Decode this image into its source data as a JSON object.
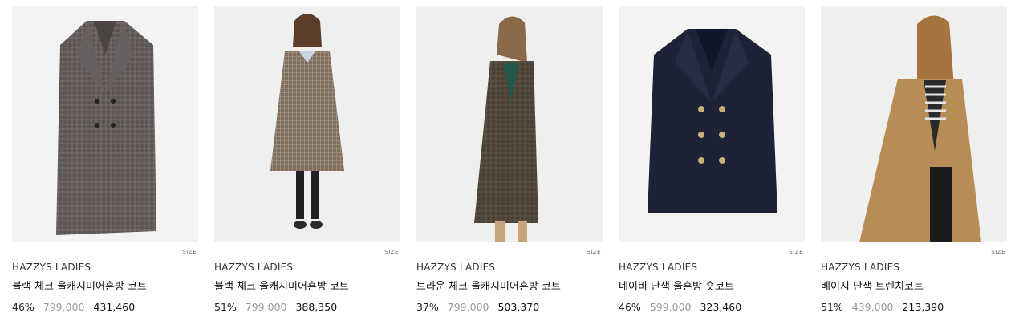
{
  "products": [
    {
      "brand": "HAZZYS LADIES",
      "name": "블랙 체크 울캐시미어혼방 코트",
      "discount": "46%",
      "original_price": "799,000",
      "sale_price": "431,460",
      "size_label": "SIZE",
      "coat_color": "#5b5553",
      "bg_color": "#f3f3f3"
    },
    {
      "brand": "HAZZYS LADIES",
      "name": "블랙 체크 울캐시미어혼방 코트",
      "discount": "51%",
      "original_price": "799,000",
      "sale_price": "388,350",
      "size_label": "SIZE",
      "coat_color": "#7d6e60",
      "bg_color": "#efefee"
    },
    {
      "brand": "HAZZYS LADIES",
      "name": "브라운 체크 울캐시미어혼방 코트",
      "discount": "37%",
      "original_price": "799,000",
      "sale_price": "503,370",
      "size_label": "SIZE",
      "coat_color": "#4a4236",
      "bg_color": "#efefee"
    },
    {
      "brand": "HAZZYS LADIES",
      "name": "네이비 단색 울혼방 숏코트",
      "discount": "46%",
      "original_price": "599,000",
      "sale_price": "323,460",
      "size_label": "SIZE",
      "coat_color": "#1d2236",
      "bg_color": "#f3f3f3"
    },
    {
      "brand": "HAZZYS LADIES",
      "name": "베이지 단색 트렌치코트",
      "discount": "51%",
      "original_price": "439,000",
      "sale_price": "213,390",
      "size_label": "SIZE",
      "coat_color": "#b78c57",
      "bg_color": "#efefee"
    }
  ]
}
